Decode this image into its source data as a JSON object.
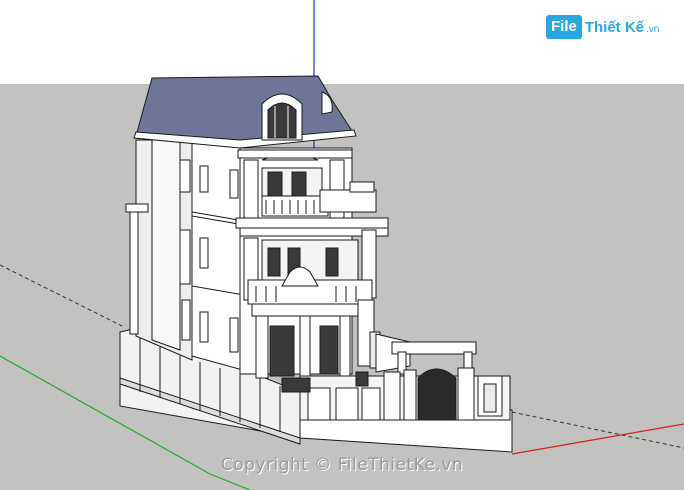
{
  "watermark": {
    "logo_box": "File",
    "logo_text": "Thiết Kế",
    "logo_domain": ".vn",
    "copyright": "Copyright © FileThietKe.vn"
  },
  "colors": {
    "sky": "#ffffff",
    "ground": "#c2c2c0",
    "roof": "#6f7596",
    "wall": "#ffffff",
    "shadow_wall": "#e4e4e4",
    "line": "#1b1b1b",
    "axis_red": "#d42020",
    "axis_green": "#22aa22",
    "axis_blue": "#2030d0",
    "brand": "#29a8e0"
  }
}
